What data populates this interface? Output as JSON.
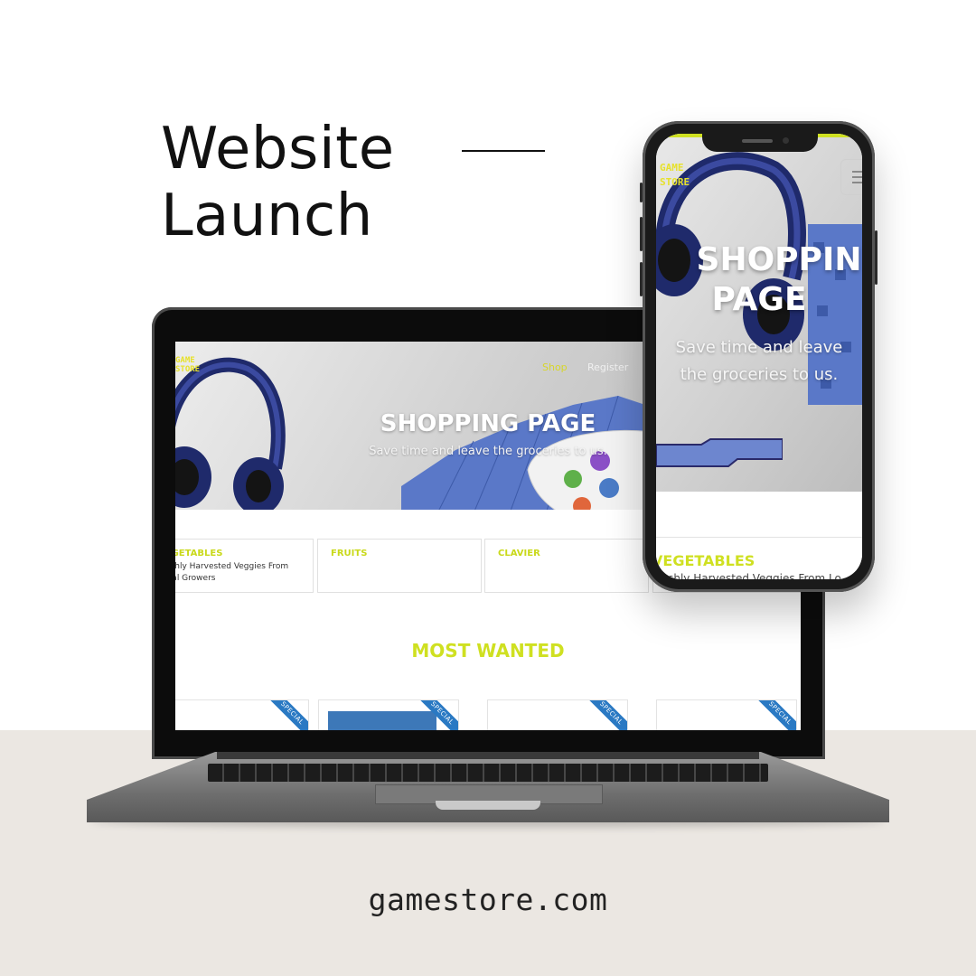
{
  "headline": {
    "line1": "Website",
    "line2": "Launch"
  },
  "footer": {
    "url": "gamestore.com"
  },
  "laptop_site": {
    "brand": {
      "line1": "GAME",
      "line2": "STORE"
    },
    "nav": {
      "shop": "Shop",
      "register": "Register"
    },
    "hero": {
      "title": "SHOPPING PAGE",
      "subtitle": "Save time and leave the groceries to us."
    },
    "categories": [
      {
        "name": "VEGETABLES",
        "desc": "Freshly Harvested Veggies From Local Growers"
      },
      {
        "name": "FRUITS",
        "desc": ""
      },
      {
        "name": "CLAVIER",
        "desc": ""
      },
      {
        "name": "",
        "desc": ""
      }
    ],
    "section_title": "MOST WANTED",
    "products": [
      {
        "badge": "SPECIAL"
      },
      {
        "badge": "SPECIAL"
      },
      {
        "badge": "SPECIAL"
      },
      {
        "badge": "SPECIAL"
      }
    ]
  },
  "phone_site": {
    "brand": {
      "line1": "GAME",
      "line2": "STORE"
    },
    "hero": {
      "title_line1": "SHOPPIN",
      "title_line2": "PAGE",
      "subtitle": "Save time and leave the groceries to us."
    },
    "card": {
      "name": "VEGETABLES",
      "desc": "Freshly Harvested Veggies From Lo"
    }
  },
  "colors": {
    "accent": "#cfe021",
    "ribbon": "#2a79c3",
    "floor": "#ebe7e2",
    "headphone": "#1f2a6b",
    "pixel_blue": "#5a78c8"
  },
  "icons": {
    "menu": "hamburger-menu-icon"
  }
}
